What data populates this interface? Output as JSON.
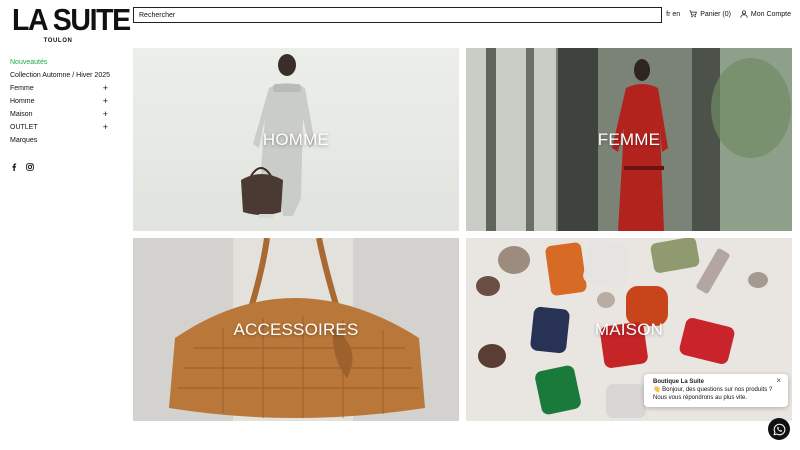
{
  "logo": {
    "main": "LA SUITE",
    "sub": "TOULON"
  },
  "sidebar": {
    "items": [
      {
        "label": "Nouveautés",
        "plus": ""
      },
      {
        "label": "Collection Automne / Hiver 2025",
        "plus": ""
      },
      {
        "label": "Femme",
        "plus": "+"
      },
      {
        "label": "Homme",
        "plus": "+"
      },
      {
        "label": "Maison",
        "plus": "+"
      },
      {
        "label": "OUTLET",
        "plus": "+"
      },
      {
        "label": "Marques",
        "plus": ""
      }
    ],
    "socials": [
      "facebook-icon",
      "instagram-icon"
    ]
  },
  "search": {
    "placeholder": "Rechercher"
  },
  "top_nav": {
    "language": "fr en",
    "cart": "Panier (0)",
    "account": "Mon Compte"
  },
  "tiles": [
    {
      "label": "HOMME"
    },
    {
      "label": "FEMME"
    },
    {
      "label": "ACCESSOIRES"
    },
    {
      "label": "MAISON"
    }
  ],
  "chat": {
    "title": "Boutique La Suite",
    "line1": "👋 Bonjour, des questions sur nos produits ?",
    "line2": "Nous vous répondrons au plus vite.",
    "close": "×"
  },
  "colors": {
    "accent": "#1fa84a",
    "text": "#111111"
  }
}
